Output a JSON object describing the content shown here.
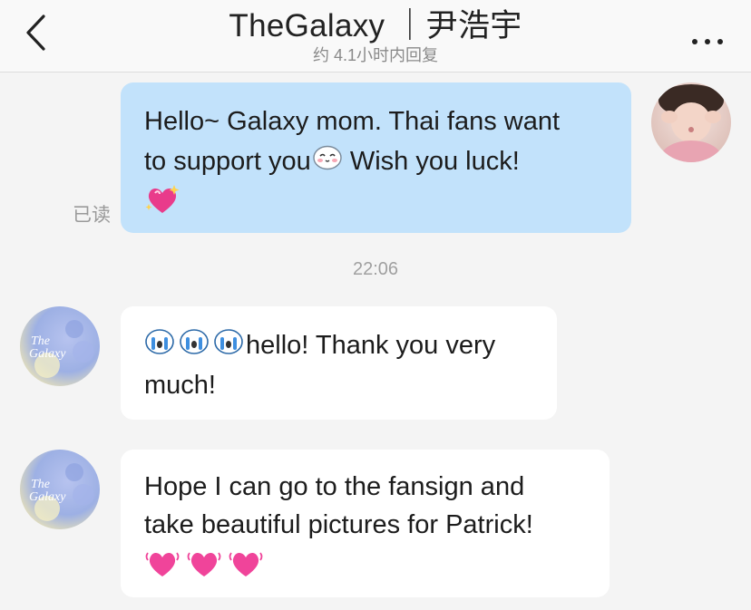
{
  "header": {
    "title": "TheGalaxy ｜尹浩宇",
    "status": "约 4.1小时内回复",
    "back_icon": "chevron-left-icon",
    "more_icon": "more-dots-icon"
  },
  "messages": {
    "outgoing": {
      "line1": "Hello~ Galaxy mom. Thai fans want",
      "line2_text": "to support you",
      "line2_after": " Wish you luck!",
      "emoji1": "cute-blush-face-emoji",
      "emoji2": "sparkling-heart-emoji",
      "read_status": "已读",
      "accent": "#c2e2fb"
    },
    "timestamp": "22:06",
    "incoming1": {
      "emoji": "crying-face-emoji",
      "line1_text": "hello! Thank you very",
      "line2": "much!"
    },
    "incoming2": {
      "line1": "Hope I can go to the fansign and",
      "line2": "take beautiful pictures for Patrick!",
      "emoji": "beating-heart-emoji"
    }
  },
  "avatars": {
    "self": "user-avatar",
    "contact": "thegalaxy-avatar",
    "contact_logo": "The Galaxy"
  }
}
